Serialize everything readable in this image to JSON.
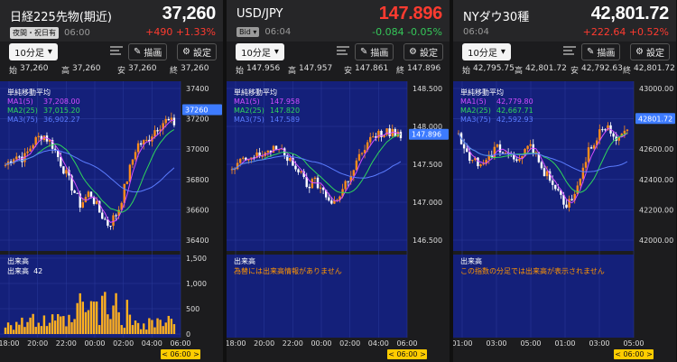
{
  "panels": [
    {
      "name": "日経225先物(期近)",
      "price": "37,260",
      "price_color": "white",
      "session_tag": "夜間・祝日有",
      "time": "06:00",
      "change": "+490",
      "change_pct": "+1.33%",
      "change_color": "#ff3b30",
      "interval": "10分足",
      "draw_label": "描画",
      "settings_label": "設定",
      "ohlc": {
        "open_label": "始",
        "open": "37,260",
        "high_label": "高",
        "high": "37,260",
        "low_label": "安",
        "low": "37,260",
        "close_label": "終",
        "close": "37,260"
      },
      "ma_title": "単純移動平均",
      "ma": [
        {
          "label": "MA1(5)",
          "value": "37,208.00"
        },
        {
          "label": "MA2(25)",
          "value": "37,015.20"
        },
        {
          "label": "MA3(75)",
          "value": "36,902.27"
        }
      ],
      "y_ticks": [
        "37400",
        "37200",
        "37000",
        "36800",
        "36600",
        "36400"
      ],
      "current_label": "37260",
      "vol_title": "出来高",
      "vol_label": "出来高",
      "vol_value": "42",
      "vol_note": "",
      "vol_ticks": [
        "1,500",
        "1,000",
        "500",
        "0"
      ],
      "x_ticks": [
        "18:00",
        "20:00",
        "22:00",
        "00:00",
        "02:00",
        "04:00",
        "06:00"
      ],
      "time_badge": "< 06:00 >"
    },
    {
      "name": "USD/JPY",
      "price": "147.896",
      "price_color": "#ff3b30",
      "session_tag": "Bid ▾",
      "time": "06:04",
      "change": "-0.084",
      "change_pct": "-0.05%",
      "change_color": "#35c759",
      "interval": "10分足",
      "draw_label": "描画",
      "settings_label": "設定",
      "ohlc": {
        "open_label": "始",
        "open": "147.956",
        "high_label": "高",
        "high": "147.957",
        "low_label": "安",
        "low": "147.861",
        "close_label": "終",
        "close": "147.896"
      },
      "ma_title": "単純移動平均",
      "ma": [
        {
          "label": "MA1(5)",
          "value": "147.958"
        },
        {
          "label": "MA2(25)",
          "value": "147.820"
        },
        {
          "label": "MA3(75)",
          "value": "147.589"
        }
      ],
      "y_ticks": [
        "148.500",
        "148.000",
        "147.500",
        "147.000",
        "146.500"
      ],
      "current_label": "147.896",
      "vol_title": "出来高",
      "vol_label": "",
      "vol_value": "",
      "vol_note": "為替には出来高情報がありません",
      "vol_ticks": [],
      "x_ticks": [
        "18:00",
        "20:00",
        "22:00",
        "00:00",
        "02:00",
        "04:00",
        "06:00"
      ],
      "time_badge": "< 06:00 >"
    },
    {
      "name": "NYダウ30種",
      "price": "42,801.72",
      "price_color": "white",
      "session_tag": "",
      "time": "06:04",
      "change": "+222.64",
      "change_pct": "+0.52%",
      "change_color": "#ff3b30",
      "interval": "10分足",
      "draw_label": "描画",
      "settings_label": "設定",
      "ohlc": {
        "open_label": "始",
        "open": "42,795.75",
        "high_label": "高",
        "high": "42,801.72",
        "low_label": "安",
        "low": "42,792.63",
        "close_label": "終",
        "close": "42,801.72"
      },
      "ma_title": "単純移動平均",
      "ma": [
        {
          "label": "MA1(5)",
          "value": "42,779.80"
        },
        {
          "label": "MA2(25)",
          "value": "42,667.71"
        },
        {
          "label": "MA3(75)",
          "value": "42,592.93"
        }
      ],
      "y_ticks": [
        "43000.00",
        "42800.00",
        "42600.00",
        "42400.00",
        "42200.00",
        "42000.00"
      ],
      "current_label": "42801.72",
      "vol_title": "出来高",
      "vol_label": "",
      "vol_value": "",
      "vol_note": "この指数の分足では出来高が表示されません",
      "vol_ticks": [],
      "x_ticks": [
        "01:00",
        "03:00",
        "05:00",
        "01:00",
        "03:00",
        "05:00"
      ],
      "time_badge": "< 06:00 >"
    }
  ],
  "colors": {
    "chart_bg": "#14207a",
    "up": "#ff8c1a",
    "down": "#ffffff",
    "ma1": "#d24cff",
    "ma2": "#2fd65a",
    "ma3": "#5b7cff",
    "volume": "#ffb020",
    "badge": "#ffcc00",
    "current": "#3d7bff"
  }
}
